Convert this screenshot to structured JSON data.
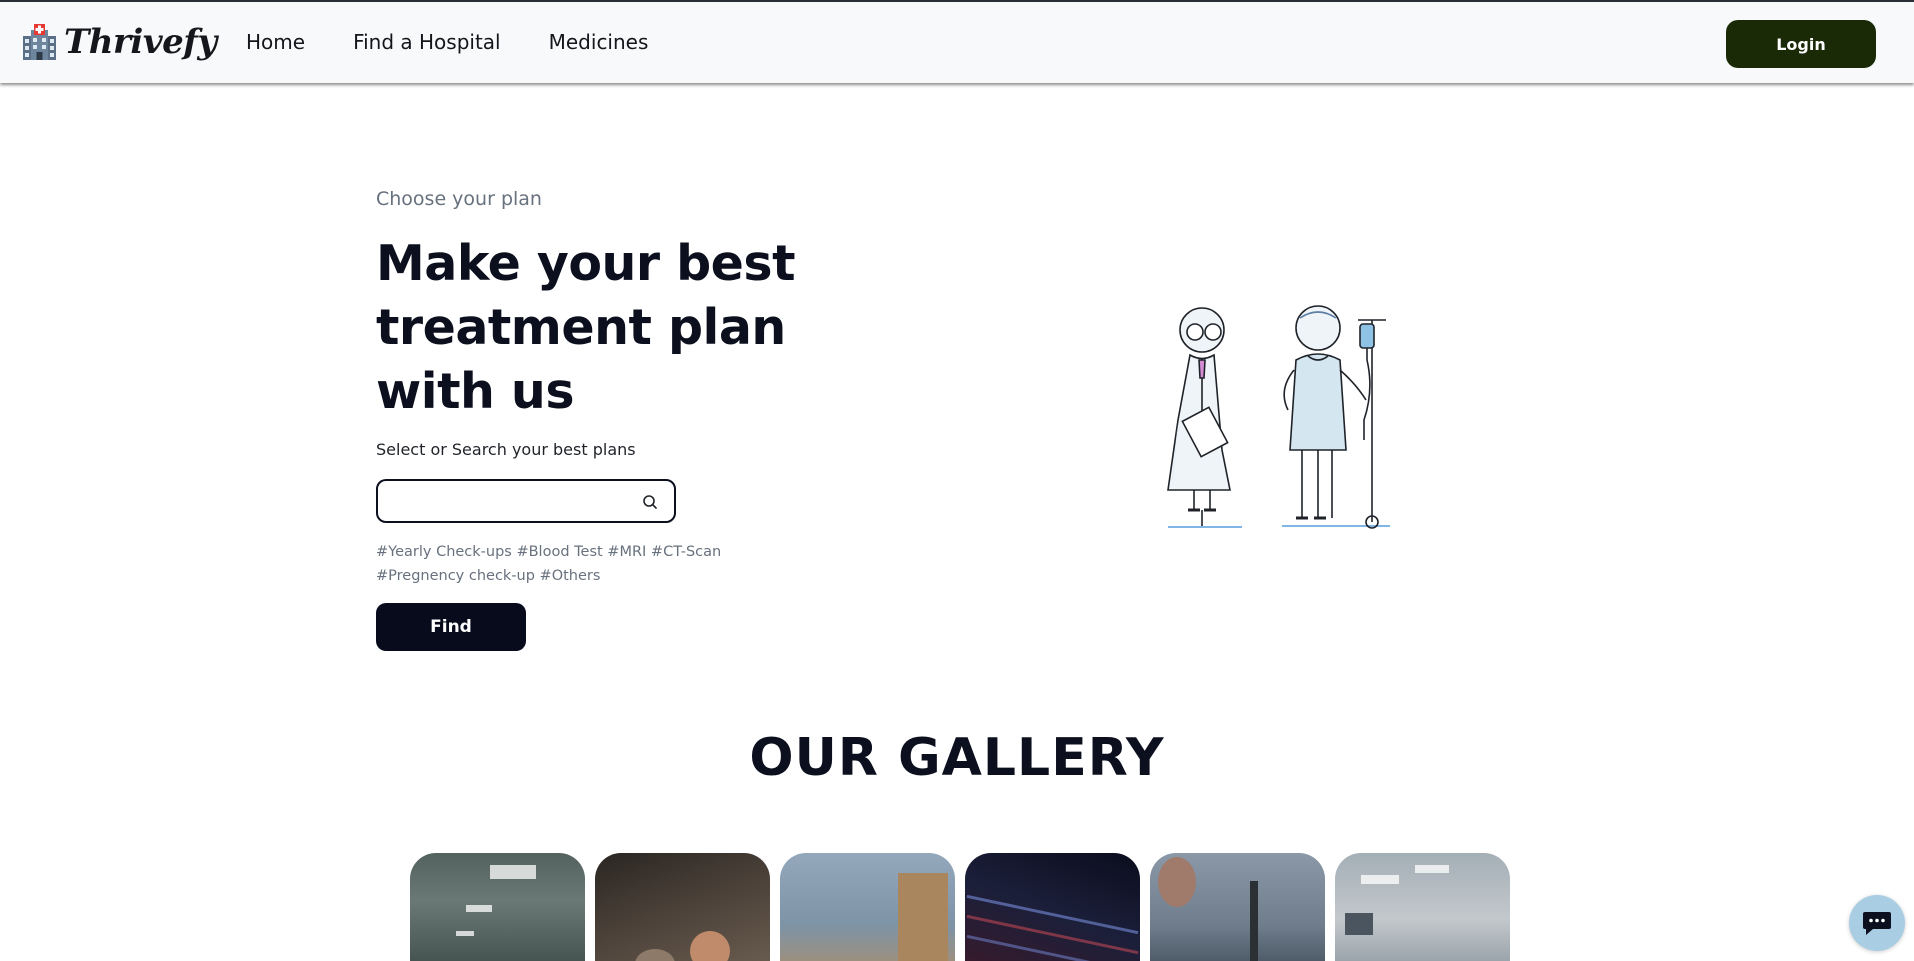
{
  "nav": {
    "brand": "Thrivefy",
    "links": [
      "Home",
      "Find a Hospital",
      "Medicines"
    ],
    "login": "Login"
  },
  "hero": {
    "eyebrow": "Choose your plan",
    "headline": "Make your best treatment plan with us",
    "search_label": "Select or Search your best plans",
    "search_value": "",
    "tags": "#Yearly Check-ups #Blood Test #MRI #CT-Scan #Pregnency check-up #Others",
    "find": "Find"
  },
  "gallery": {
    "title": "OUR GALLERY",
    "images": [
      "hospital-corridor",
      "surgery-team",
      "patient-room",
      "mri-scanner",
      "operating-room",
      "ward-interior"
    ]
  },
  "colors": {
    "login_bg": "#1b2a06",
    "find_bg": "#070b1c",
    "chat_bg": "#a9cde3"
  },
  "icons": {
    "brand": "hospital-building-icon",
    "search": "search-icon",
    "chat": "chat-icon"
  }
}
